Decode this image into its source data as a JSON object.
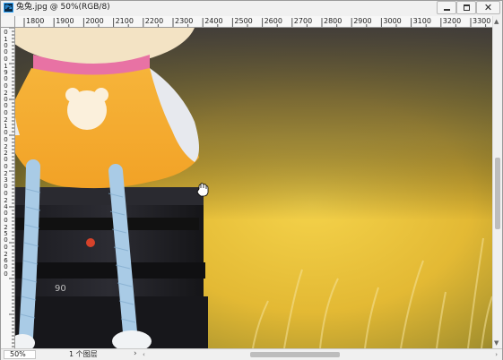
{
  "window": {
    "app_icon": "Ps",
    "title": "兔兔.jpg @ 50%(RGB/8)",
    "controls": {
      "minimize_icon": "minimize-icon",
      "maximize_icon": "maximize-icon",
      "close_glyph": "✕"
    }
  },
  "rulers": {
    "horizontal": [
      "1800",
      "1900",
      "2000",
      "2100",
      "2200",
      "2300",
      "2400",
      "2500",
      "2600",
      "2700",
      "2800",
      "2900",
      "3000",
      "3100",
      "3200",
      "3300"
    ],
    "vertical": [
      "0",
      "100",
      "0",
      "190",
      "0",
      "200",
      "0",
      "210",
      "0",
      "220",
      "0",
      "230",
      "0",
      "240",
      "0",
      "250",
      "0",
      "260",
      "0"
    ]
  },
  "status": {
    "zoom": "50%",
    "layers": "1 个图层",
    "arrow": "›"
  },
  "scrollbars": {
    "up": "▲",
    "down": "▼",
    "left": "‹",
    "right": "›"
  },
  "cursor_icon": "hand-tool-icon",
  "colors": {
    "canvas_bg": "#e7c13a",
    "photoshop_blue": "#31a8ff"
  }
}
